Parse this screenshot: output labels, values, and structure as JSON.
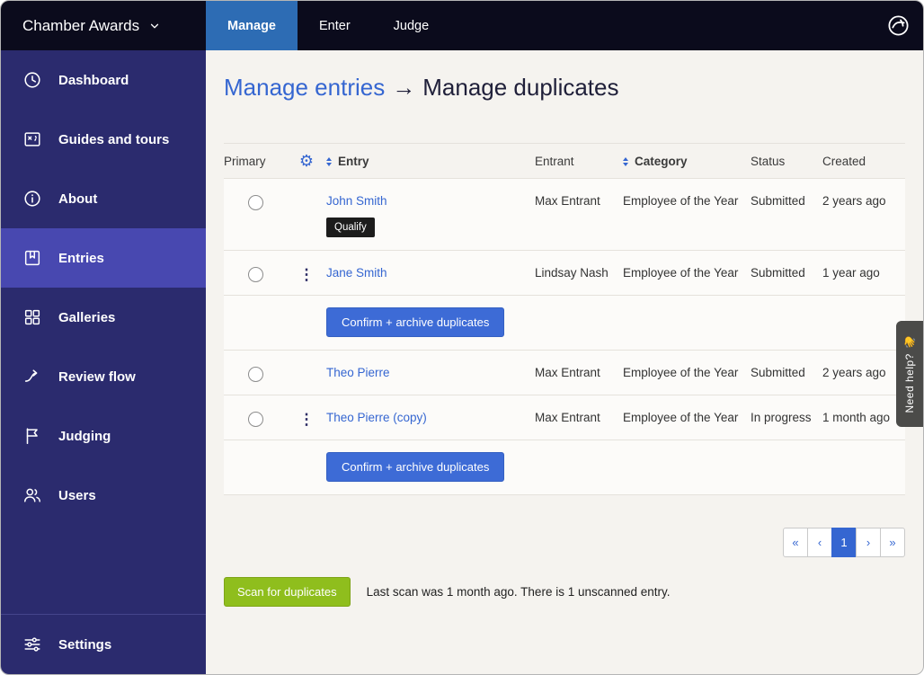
{
  "colors": {
    "accent_blue": "#3566d1",
    "active_tab_blue": "#2d6cb4",
    "sidebar_indigo": "#2b2b6e",
    "sidebar_active_indigo": "#4848b0",
    "scan_green": "#8fbe1d",
    "badge_black": "#1c1c1c"
  },
  "icons": {
    "gear": "⚙",
    "kebab": "⋮"
  },
  "topbar": {
    "brand": "Chamber Awards",
    "tabs": [
      {
        "label": "Manage",
        "active": true
      },
      {
        "label": "Enter",
        "active": false
      },
      {
        "label": "Judge",
        "active": false
      }
    ]
  },
  "sidebar": {
    "items": [
      {
        "label": "Dashboard"
      },
      {
        "label": "Guides and tours"
      },
      {
        "label": "About"
      },
      {
        "label": "Entries",
        "active": true
      },
      {
        "label": "Galleries"
      },
      {
        "label": "Review flow"
      },
      {
        "label": "Judging"
      },
      {
        "label": "Users"
      }
    ],
    "settings_label": "Settings"
  },
  "main": {
    "breadcrumb": {
      "link": "Manage entries",
      "arrow": "→",
      "current": "Manage duplicates"
    },
    "table": {
      "headers": {
        "primary": "Primary",
        "entry": "Entry",
        "entrant": "Entrant",
        "category": "Category",
        "status": "Status",
        "created": "Created"
      },
      "groups": [
        {
          "action_label": "Confirm + archive duplicates",
          "rows": [
            {
              "name": "John Smith",
              "badge": "Qualify",
              "entrant": "Max Entrant",
              "category": "Employee of the Year",
              "status": "Submitted",
              "created": "2 years ago"
            },
            {
              "name": "Jane Smith",
              "entrant": "Lindsay Nash",
              "category": "Employee of the Year",
              "status": "Submitted",
              "created": "1 year ago"
            }
          ]
        },
        {
          "action_label": "Confirm + archive duplicates",
          "rows": [
            {
              "name": "Theo Pierre",
              "entrant": "Max Entrant",
              "category": "Employee of the Year",
              "status": "Submitted",
              "created": "2 years ago"
            },
            {
              "name": "Theo Pierre (copy)",
              "entrant": "Max Entrant",
              "category": "Employee of the Year",
              "status": "In progress",
              "created": "1 month ago"
            }
          ]
        }
      ]
    },
    "pagination": {
      "first": "«",
      "prev": "‹",
      "current": "1",
      "next": "›",
      "last": "»"
    },
    "scan": {
      "button_label": "Scan for duplicates",
      "status_text": "Last scan was 1 month ago. There is 1 unscanned entry."
    }
  },
  "help_tab": {
    "label": "Need help?",
    "emoji": "👋"
  }
}
